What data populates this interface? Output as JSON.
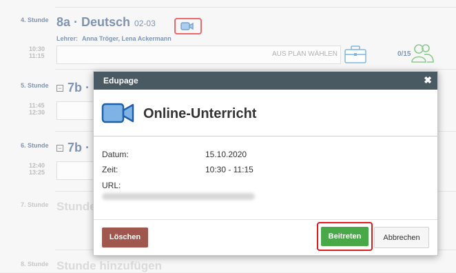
{
  "lessons": [
    {
      "label": "4. Stunde",
      "time_start": "10:30",
      "time_end": "11:15",
      "title": "8a · Deutsch",
      "room": "02-03",
      "teachers_label": "Lehrer:",
      "teachers": "Anna Tröger, Lena Ackermann",
      "plan_button": "AUS PLAN WÄHLEN",
      "attendance": "0/15"
    },
    {
      "label": "5. Stunde",
      "time_start": "11:45",
      "time_end": "12:30",
      "title": "7b ·"
    },
    {
      "label": "6. Stunde",
      "time_start": "12:40",
      "time_end": "13:25",
      "title": "7b ·"
    },
    {
      "label": "7. Stunde",
      "title": "Stunde"
    },
    {
      "label": "8. Stunde",
      "title": "Stunde hinzufügen"
    }
  ],
  "dialog": {
    "header": "Edupage",
    "close_glyph": "✖",
    "title": "Online-Unterricht",
    "fields": {
      "date_label": "Datum:",
      "date_value": "15.10.2020",
      "time_label": "Zeit:",
      "time_value": "10:30 - 11:15",
      "url_label": "URL:"
    },
    "buttons": {
      "delete": "Löschen",
      "join": "Beitreten",
      "cancel": "Abbrechen"
    }
  },
  "colors": {
    "accent_blue": "#3a5a8c",
    "join_green": "#49a848",
    "delete_red": "#a0574d",
    "highlight_red": "#e0191c",
    "dialog_header": "#4a5a63"
  },
  "icons": [
    "video-camera-icon",
    "briefcase-icon",
    "people-icon",
    "collapse-icon",
    "close-icon"
  ]
}
